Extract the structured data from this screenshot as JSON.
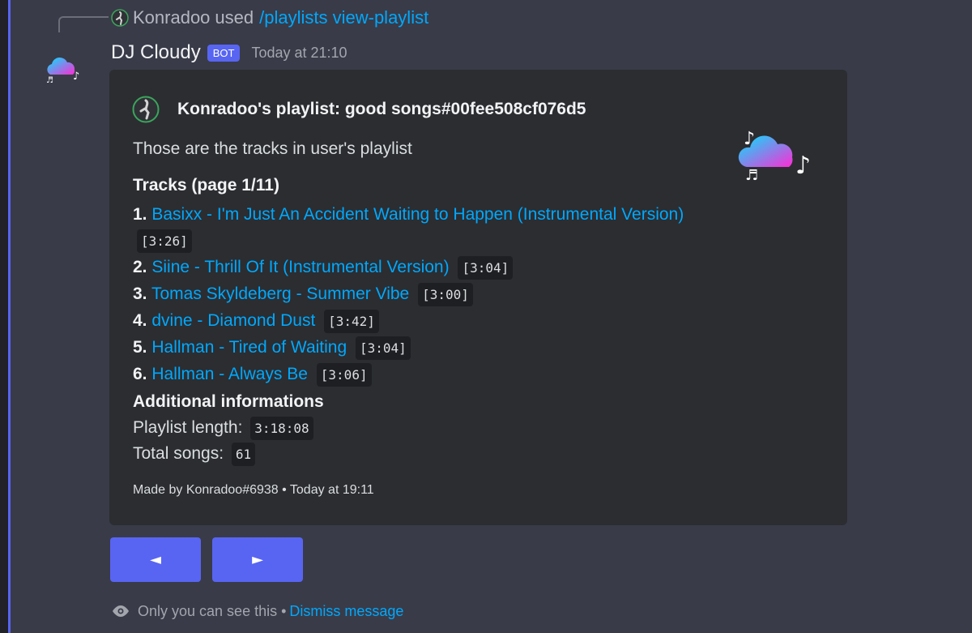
{
  "reply": {
    "user": "Konradoo",
    "used_text": "used",
    "command": "/playlists view-playlist"
  },
  "message": {
    "bot_name": "DJ Cloudy",
    "bot_badge": "BOT",
    "timestamp": "Today at 21:10"
  },
  "embed": {
    "author": "Konradoo's playlist: good songs#00fee508cf076d5",
    "description": "Those are the tracks in user's playlist",
    "tracks_title": "Tracks (page 1/11)",
    "tracks": [
      {
        "num": "1.",
        "title": "Basixx - I'm Just An Accident Waiting to Happen (Instrumental Version)",
        "duration": "[3:26]"
      },
      {
        "num": "2.",
        "title": "Siine - Thrill Of It (Instrumental Version)",
        "duration": "[3:04]"
      },
      {
        "num": "3.",
        "title": "Tomas Skyldeberg - Summer Vibe",
        "duration": "[3:00]"
      },
      {
        "num": "4.",
        "title": "dvine - Diamond Dust",
        "duration": "[3:42]"
      },
      {
        "num": "5.",
        "title": "Hallman - Tired of Waiting",
        "duration": "[3:04]"
      },
      {
        "num": "6.",
        "title": "Hallman - Always Be",
        "duration": "[3:06]"
      }
    ],
    "additional_title": "Additional informations",
    "playlist_length_label": "Playlist length:",
    "playlist_length": "3:18:08",
    "total_songs_label": "Total songs:",
    "total_songs": "61",
    "footer": "Made by Konradoo#6938 • Today at 19:11"
  },
  "buttons": {
    "prev_label": "◄",
    "next_label": "►"
  },
  "ephemeral": {
    "text": "Only you can see this •",
    "dismiss": "Dismiss message"
  },
  "colors": {
    "background": "#393b48",
    "embed_bg": "#2b2d31",
    "accent": "#5865f2",
    "link": "#00a8fc"
  },
  "icons": [
    "user-avatar-icon",
    "cloud-music-icon",
    "eye-icon"
  ]
}
